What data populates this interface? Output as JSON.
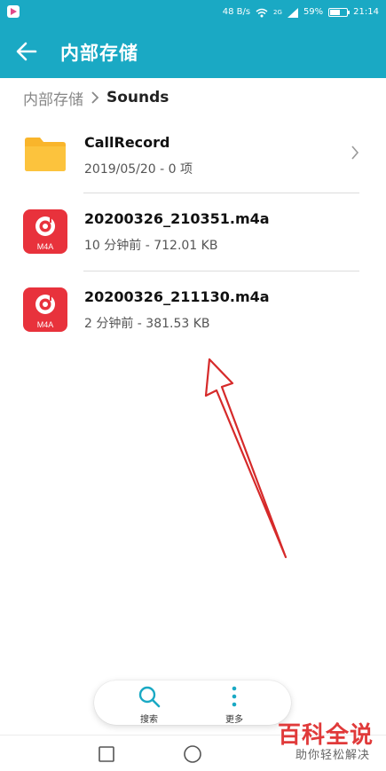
{
  "status_bar": {
    "network_speed": "48 B/s",
    "network_type": "2G",
    "battery_percent": "59%",
    "battery_level": 0.59,
    "time": "21:14"
  },
  "app_bar": {
    "title": "内部存储"
  },
  "breadcrumb": {
    "root": "内部存储",
    "current": "Sounds"
  },
  "files": [
    {
      "name": "CallRecord",
      "meta": "2019/05/20 - 0 项",
      "type": "folder"
    },
    {
      "name": "20200326_210351.m4a",
      "meta": "10 分钟前 - 712.01 KB",
      "type": "audio",
      "badge": "M4A"
    },
    {
      "name": "20200326_211130.m4a",
      "meta": "2 分钟前 - 381.53 KB",
      "type": "audio",
      "badge": "M4A"
    }
  ],
  "toolbar": {
    "search_label": "搜索",
    "more_label": "更多"
  },
  "watermark": {
    "title": "百科全说",
    "subtitle": "助你轻松解决"
  },
  "colors": {
    "accent": "#1aa9c4",
    "folder": "#f9b52b",
    "audio": "#e8323c",
    "annotation_arrow": "#d62a2a"
  }
}
